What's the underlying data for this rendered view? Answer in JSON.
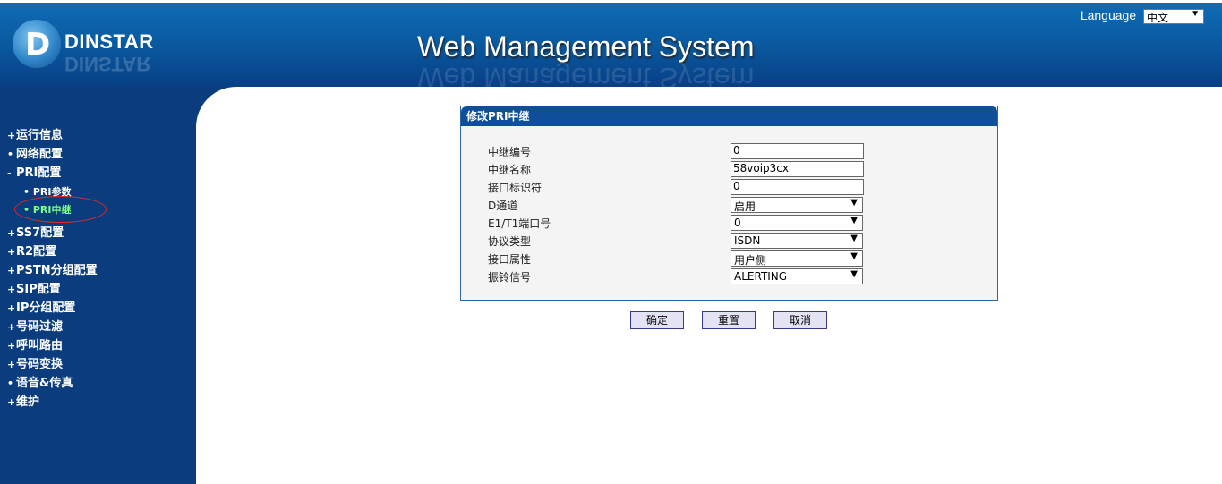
{
  "header": {
    "brand": "DINSTAR",
    "logo_letter": "D",
    "system_title": "Web Management System",
    "language_label": "Language",
    "language_value": "中文"
  },
  "sidebar": {
    "items": [
      {
        "label": "运行信息",
        "bullet": "+"
      },
      {
        "label": "网络配置",
        "bullet": "•"
      },
      {
        "label": "PRI配置",
        "bullet": "-"
      },
      {
        "label": "PRI参数",
        "bullet": "•"
      },
      {
        "label": "PRI中继",
        "bullet": "•"
      },
      {
        "label": "SS7配置",
        "bullet": "+"
      },
      {
        "label": "R2配置",
        "bullet": "+"
      },
      {
        "label": "PSTN分组配置",
        "bullet": "+"
      },
      {
        "label": "SIP配置",
        "bullet": "+"
      },
      {
        "label": "IP分组配置",
        "bullet": "+"
      },
      {
        "label": "号码过滤",
        "bullet": "+"
      },
      {
        "label": "呼叫路由",
        "bullet": "+"
      },
      {
        "label": "号码变换",
        "bullet": "+"
      },
      {
        "label": "语音&传真",
        "bullet": "•"
      },
      {
        "label": "维护",
        "bullet": "+"
      }
    ]
  },
  "form": {
    "title": "修改PRI中继",
    "fields": [
      {
        "label": "中继编号",
        "value": "0"
      },
      {
        "label": "中继名称",
        "value": "58voip3cx"
      },
      {
        "label": "接口标识符",
        "value": "0"
      },
      {
        "label": "D通道",
        "value": "启用"
      },
      {
        "label": "E1/T1端口号",
        "value": "0"
      },
      {
        "label": "协议类型",
        "value": "ISDN"
      },
      {
        "label": "接口属性",
        "value": "用户侧"
      },
      {
        "label": "振铃信号",
        "value": "ALERTING"
      }
    ]
  },
  "buttons": {
    "ok": "确定",
    "reset": "重置",
    "cancel": "取消"
  },
  "icons": {
    "dropdown": "▼"
  },
  "colors": {
    "header_blue": "#0a5aa0",
    "sidebar_blue": "#0b3d7e",
    "active_item": "#7cff8a",
    "highlight": "#d92b2b"
  }
}
